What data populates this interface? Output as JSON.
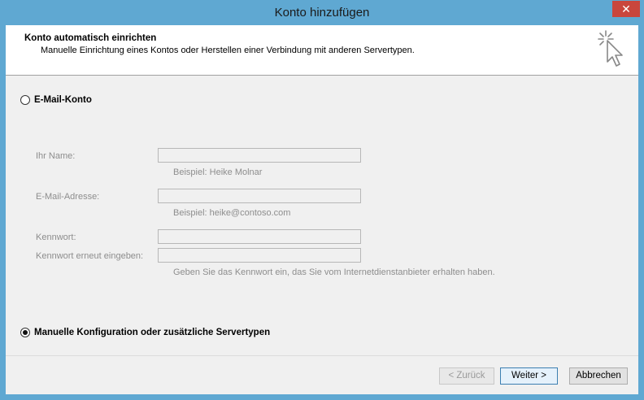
{
  "window": {
    "title": "Konto hinzufügen",
    "close_glyph": "✕"
  },
  "header": {
    "title": "Konto automatisch einrichten",
    "subtitle": "Manuelle Einrichtung eines Kontos oder Herstellen einer Verbindung mit anderen Servertypen."
  },
  "options": {
    "email_account": {
      "label": "E-Mail-Konto",
      "selected": false
    },
    "manual": {
      "label": "Manuelle Konfiguration oder zusätzliche Servertypen",
      "selected": true
    }
  },
  "form": {
    "name": {
      "label": "Ihr Name:",
      "value": "",
      "hint": "Beispiel: Heike Molnar"
    },
    "email": {
      "label": "E-Mail-Adresse:",
      "value": "",
      "hint": "Beispiel: heike@contoso.com"
    },
    "password": {
      "label": "Kennwort:",
      "value": ""
    },
    "password_confirm": {
      "label": "Kennwort erneut eingeben:",
      "value": ""
    },
    "password_hint": "Geben Sie das Kennwort ein, das Sie vom Internetdienstanbieter erhalten haben."
  },
  "buttons": {
    "back": "< Zurück",
    "next": "Weiter >",
    "cancel": "Abbrechen"
  },
  "icons": {
    "wizard": "wizard-cursor-icon"
  },
  "colors": {
    "title_bar": "#5fa8d2",
    "close_button": "#c9463d",
    "primary_border": "#3c7fb1"
  }
}
